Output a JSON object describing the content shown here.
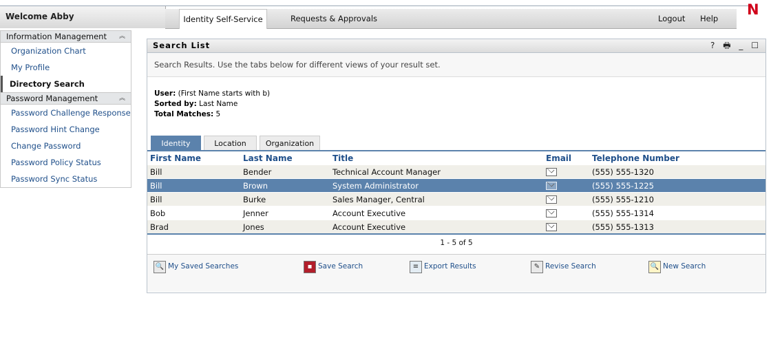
{
  "header": {
    "welcome": "Welcome Abby",
    "tabs": [
      {
        "label": "Identity Self-Service"
      },
      {
        "label": "Requests & Approvals"
      }
    ],
    "logout": "Logout",
    "help": "Help",
    "logo": "N"
  },
  "sidebar": {
    "groups": [
      {
        "title": "Information Management",
        "items": [
          "Organization Chart",
          "My Profile",
          "Directory Search"
        ]
      },
      {
        "title": "Password Management",
        "items": [
          "Password Challenge Response",
          "Password Hint Change",
          "Change Password",
          "Password Policy Status",
          "Password Sync Status"
        ]
      }
    ]
  },
  "panel": {
    "title": "Search List",
    "tools": {
      "help": "?",
      "print": "🖶",
      "minimize": "_",
      "maximize": "☐"
    },
    "intro": "Search Results. Use the tabs below for different views of your result set.",
    "criteria": {
      "user_label": "User:",
      "user_value": "(First Name starts with b)",
      "sorted_label": "Sorted by:",
      "sorted_value": "Last Name",
      "total_label": "Total Matches:",
      "total_value": "5"
    },
    "tabs": [
      "Identity",
      "Location",
      "Organization"
    ],
    "table": {
      "columns": [
        "First Name",
        "Last Name",
        "Title",
        "Email",
        "Telephone Number"
      ],
      "rows": [
        {
          "first": "Bill",
          "last": "Bender",
          "title": "Technical Account Manager",
          "phone": "(555) 555-1320"
        },
        {
          "first": "Bill",
          "last": "Brown",
          "title": "System Administrator",
          "phone": "(555) 555-1225"
        },
        {
          "first": "Bill",
          "last": "Burke",
          "title": "Sales Manager, Central",
          "phone": "(555) 555-1210"
        },
        {
          "first": "Bob",
          "last": "Jenner",
          "title": "Account Executive",
          "phone": "(555) 555-1314"
        },
        {
          "first": "Brad",
          "last": "Jones",
          "title": "Account Executive",
          "phone": "(555) 555-1313"
        }
      ],
      "selected_row": 1
    },
    "pager": "1 - 5 of 5",
    "actions": {
      "my_saved_searches": "My Saved Searches",
      "save_search": "Save Search",
      "export_results": "Export Results",
      "revise_search": "Revise Search",
      "new_search": "New Search"
    }
  },
  "colors": {
    "accent": "#5b82ac",
    "link": "#1f4f8a",
    "logo": "#d0021b"
  }
}
